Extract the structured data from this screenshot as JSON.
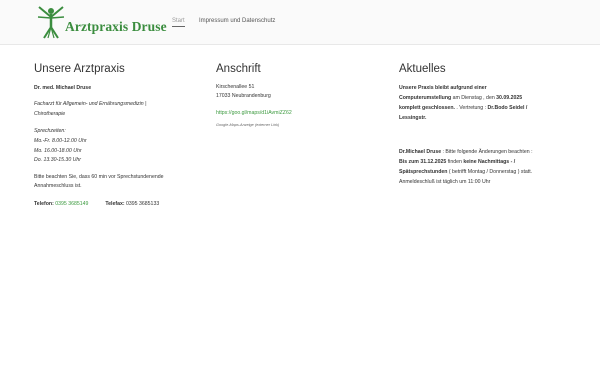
{
  "header": {
    "logo_text": "Arztpraxis Druse",
    "nav": [
      "Start",
      "Impressum und Datenschutz"
    ]
  },
  "praxis": {
    "title": "Unsere Arztpraxis",
    "doctor": "Dr. med. Michael Druse",
    "specialty_line1": "Facharzt für Allgemein- und Ernährungsmedizin |",
    "specialty_line2": "Chirotherapie",
    "hours_title": "Sprechzeiten:",
    "hours": [
      "Mo.-Fr. 8.00-12.00 Uhr",
      "Mo. 16.00-18.00 Uhr",
      "Do. 13.30-15.30 Uhr"
    ],
    "note_line1": "Bitte beachten Sie, dass 60 min vor Sprechstundenende",
    "note_line2": "Annahmeschluss ist.",
    "phone_label": "Telefon",
    "phone": "0395 3685149",
    "fax_label": "Telefax",
    "fax": "0395 3685133"
  },
  "anschrift": {
    "title": "Anschrift",
    "street": "Kirschenallee 51",
    "city": "17033 Neubrandenburg",
    "maps_link": "https://goo.gl/maps/d1iAvmiZZ62",
    "maps_note": "Google-Maps-Anzeige (externer Link)"
  },
  "aktuelles": {
    "title": "Aktuelles",
    "p1_l1": "Unsere Praxis bleibt aufgrund einer",
    "p1_l2a": "Computerumstellung",
    "p1_l2b": " am Dienstag , den ",
    "p1_l2c": "30.09.2025",
    "p1_l3a": "komplett geschlossen.",
    "p1_l3b": " . Vertretung : ",
    "p1_l3c": "Dr.Bodo Seidel /",
    "p1_l4": "Lessingstr.",
    "p2_l1a": "Dr.Michael Druse",
    "p2_l1b": " : Bitte folgende Änderungen beachten :",
    "p2_l2a": "Bis zum 31.12.2025",
    "p2_l2b": "  finden ",
    "p2_l2c": "keine Nachmittags - /",
    "p2_l3a": "Spätsprechstunden",
    "p2_l3b": " ( betrifft Montag / Donnerstag ) statt.",
    "p2_l4": "Anmeldeschluß ist täglich um 11:00 Uhr"
  },
  "colors": {
    "brand_green": "#3b8d3f",
    "link_green": "#3c9a3f"
  }
}
